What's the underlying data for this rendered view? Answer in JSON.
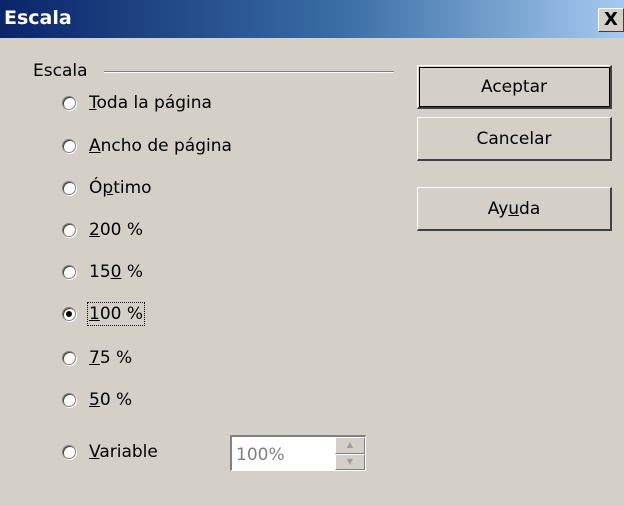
{
  "window": {
    "title": "Escala",
    "close": "X"
  },
  "group": {
    "label": "Escala"
  },
  "options": [
    {
      "pre": "",
      "key": "T",
      "post": "oda la página",
      "checked": false
    },
    {
      "pre": "",
      "key": "A",
      "post": "ncho de página",
      "checked": false
    },
    {
      "pre": "Ó",
      "key": "p",
      "post": "timo",
      "checked": false
    },
    {
      "pre": "",
      "key": "2",
      "post": "00 %",
      "checked": false
    },
    {
      "pre": "15",
      "key": "0",
      "post": " %",
      "checked": false
    },
    {
      "pre": "",
      "key": "1",
      "post": "00 %",
      "checked": true
    },
    {
      "pre": "",
      "key": "7",
      "post": "5 %",
      "checked": false
    },
    {
      "pre": "",
      "key": "5",
      "post": "0 %",
      "checked": false
    },
    {
      "pre": "",
      "key": "V",
      "post": "ariable",
      "checked": false
    }
  ],
  "variable_field": {
    "value": "100%"
  },
  "buttons": {
    "accept": "Aceptar",
    "cancel": "Cancelar",
    "help_pre": "Ay",
    "help_key": "u",
    "help_post": "da"
  }
}
